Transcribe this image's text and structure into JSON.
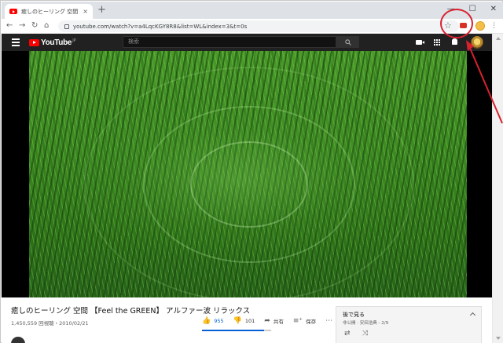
{
  "browser": {
    "tab_title": "癒しのヒーリング 空間 【Feel the",
    "tab_close": "×",
    "new_tab": "+",
    "window_controls": {
      "minimize": "—",
      "maximize": "☐",
      "close": "✕"
    },
    "nav": {
      "back": "←",
      "forward": "→",
      "reload": "↻",
      "home": "⌂"
    },
    "url": "youtube.com/watch?v=a4LqcKGY8R8&list=WL&index=3&t=0s",
    "bookmark_star": "☆",
    "menu": "⋮"
  },
  "youtube": {
    "logo_text": "YouTube",
    "logo_region": "JP",
    "search_placeholder": "検索",
    "search_icon": "🔍"
  },
  "video": {
    "title": "癒しのヒーリング 空間 【Feel the GREEN】 アルファー波 リラックス",
    "views_date": "1,450,559 回視聴・2010/02/21",
    "likes": "955",
    "dislikes": "101",
    "share_label": "共有",
    "save_label": "保存",
    "more": "⋯",
    "like_ratio": 0.9
  },
  "playlist": {
    "title": "後で見る",
    "subtitle": "非公開 · 安田浩典 - 2/9",
    "loop_icon": "⇄",
    "shuffle_icon": "⤨"
  },
  "colors": {
    "annotation": "#d8212f",
    "youtube_red": "#ff0000",
    "like_blue": "#065fd4"
  }
}
